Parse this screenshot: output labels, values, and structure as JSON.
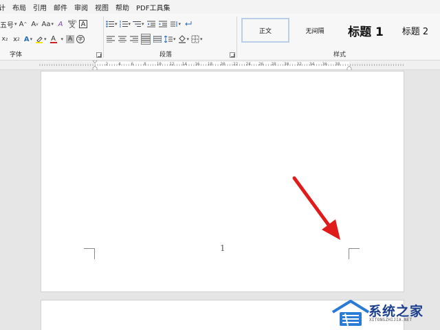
{
  "menu": {
    "items": [
      "计",
      "布局",
      "引用",
      "邮件",
      "审阅",
      "视图",
      "帮助",
      "PDF工具集"
    ]
  },
  "font_group": {
    "font_size": "五号",
    "grow_font": "A",
    "shrink_font": "A",
    "change_case": "Aa",
    "clear_format": "A",
    "char_border": "A",
    "phonetic_guide": "wén",
    "superscript": "x",
    "text_effects": "A",
    "font_color": "A",
    "char_shading": "A",
    "enclose_chars": "字",
    "label": "字体"
  },
  "paragraph_group": {
    "label": "段落"
  },
  "styles_group": {
    "label": "样式",
    "items": [
      "正文",
      "无间隔",
      "标题 1",
      "标题 2"
    ]
  },
  "ruler": {
    "numbers": [
      "2",
      "4",
      "6",
      "8",
      "10",
      "12",
      "14",
      "16",
      "18",
      "20",
      "22",
      "24",
      "26",
      "28",
      "30",
      "32",
      "34",
      "36",
      "38"
    ]
  },
  "document": {
    "page_number": "1"
  },
  "annotation": {
    "arrow_color": "#e01b1b"
  },
  "watermark": {
    "name": "系统之家",
    "sub": "XITONGZHIJIA.NET"
  }
}
